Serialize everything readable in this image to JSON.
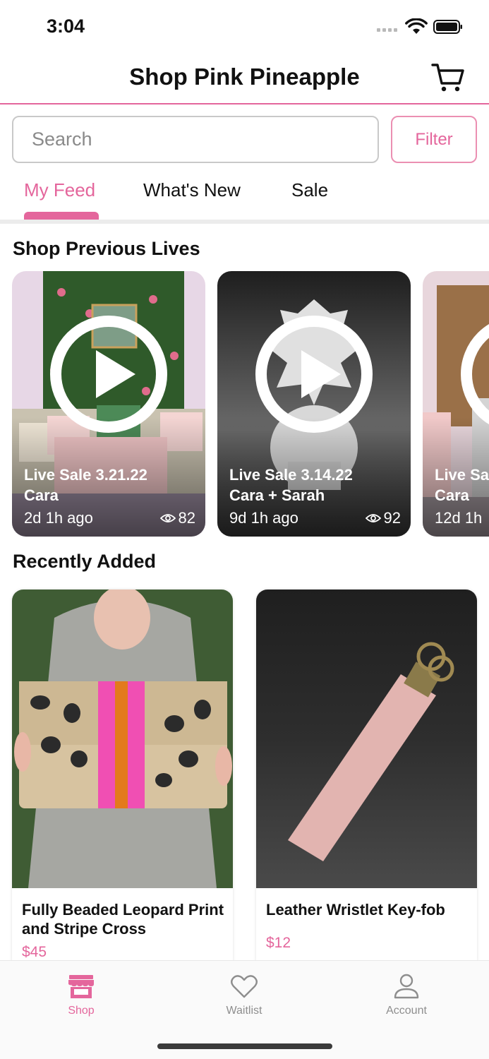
{
  "status_bar": {
    "time": "3:04"
  },
  "header": {
    "title": "Shop Pink Pineapple"
  },
  "search": {
    "placeholder": "Search",
    "value": "",
    "filter_label": "Filter"
  },
  "tabs": [
    {
      "label": "My Feed"
    },
    {
      "label": "What's New"
    },
    {
      "label": "Sale"
    }
  ],
  "active_tab": "My Feed",
  "lives": {
    "title": "Shop Previous Lives",
    "items": [
      {
        "title": "Live Sale 3.21.22",
        "host": "Cara",
        "ago": "2d 1h ago",
        "views": "82"
      },
      {
        "title": "Live Sale 3.14.22",
        "host": "Cara + Sarah",
        "ago": "9d 1h ago",
        "views": "92"
      },
      {
        "title": "Live Sa",
        "host": "Cara",
        "ago": "12d 1h",
        "views": ""
      }
    ]
  },
  "recent": {
    "title": "Recently Added",
    "items": [
      {
        "name": "Fully Beaded Leopard Print and Stripe Cross",
        "price": "$45"
      },
      {
        "name": "Leather Wristlet Key-fob",
        "price": "$12"
      }
    ]
  },
  "tabbar": [
    {
      "label": "Shop",
      "icon": "storefront-icon",
      "active": true
    },
    {
      "label": "Waitlist",
      "icon": "heart-icon",
      "active": false
    },
    {
      "label": "Account",
      "icon": "person-icon",
      "active": false
    }
  ],
  "colors": {
    "accent": "#e4669c",
    "text": "#111111",
    "muted": "#8e8e8e"
  }
}
